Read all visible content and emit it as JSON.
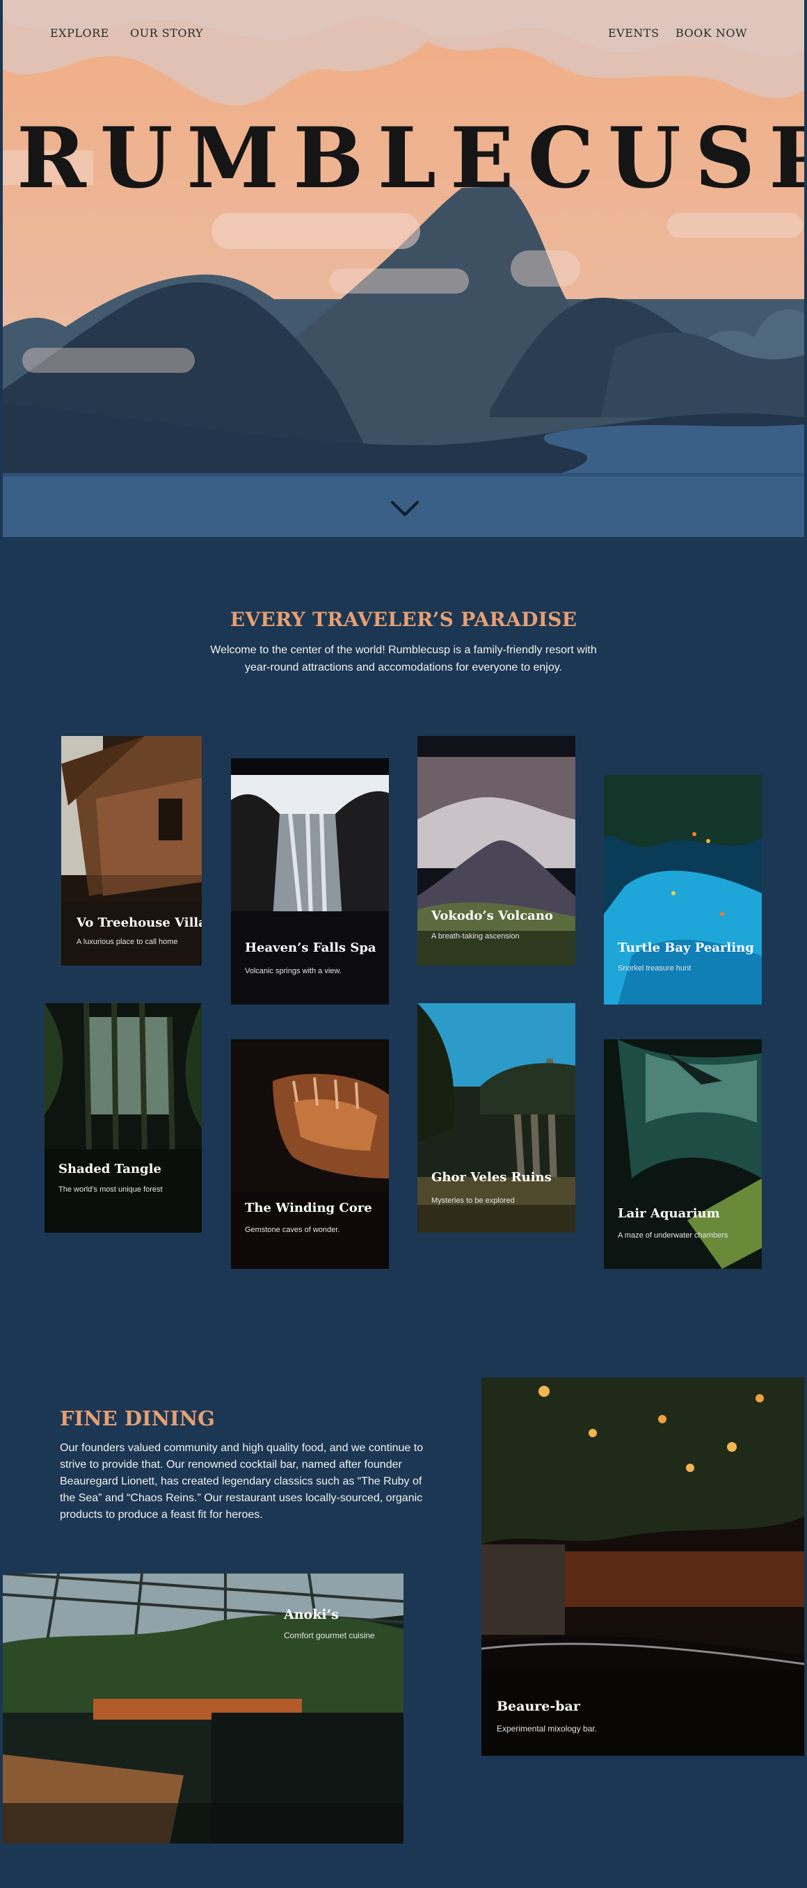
{
  "nav": {
    "left": [
      "EXPLORE",
      "OUR STORY"
    ],
    "right": [
      "EVENTS",
      "BOOK NOW"
    ]
  },
  "hero": {
    "brand": "RUMBLECUSP"
  },
  "paradise": {
    "title": "EVERY TRAVELER’S PARADISE",
    "text": "Welcome to the center of the world! Rumblecusp is a family-friendly resort with year-round attractions and accomodations for everyone to enjoy."
  },
  "attractions": [
    {
      "title": "Vo Treehouse Villas",
      "subtitle": "A luxurious place to call home"
    },
    {
      "title": "Heaven’s Falls Spa",
      "subtitle": "Volcanic springs with a view."
    },
    {
      "title": "Vokodo’s Volcano",
      "subtitle": "A breath-taking ascension"
    },
    {
      "title": "Turtle Bay Pearling",
      "subtitle": "Snorkel treasure hunt"
    },
    {
      "title": "Shaded Tangle",
      "subtitle": "The world’s most unique forest"
    },
    {
      "title": "The Winding Core",
      "subtitle": "Gemstone caves of wonder."
    },
    {
      "title": "Ghor Veles Ruins",
      "subtitle": "Mysteries to be explored"
    },
    {
      "title": "Lair Aquarium",
      "subtitle": "A maze of underwater chambers"
    }
  ],
  "dining": {
    "title": "FINE DINING",
    "text": "Our founders valued community and high quality food, and we continue to strive to provide that. Our renowned cocktail bar, named after founder Beauregard Lionett, has created legendary classics such as “The Ruby of the Sea” and “Chaos Reins.” Our restaurant uses locally-sourced, organic products to produce a feast fit for heroes.",
    "places": [
      {
        "title": "Anoki’s",
        "subtitle": "Comfort gourmet cuisine"
      },
      {
        "title": "Beaure-bar",
        "subtitle": "Experimental mixology bar."
      }
    ]
  },
  "colors": {
    "background": "#1b3753",
    "accent": "#e79f72",
    "sky": "#efb393"
  },
  "icons": [
    "chevron-down-icon"
  ]
}
